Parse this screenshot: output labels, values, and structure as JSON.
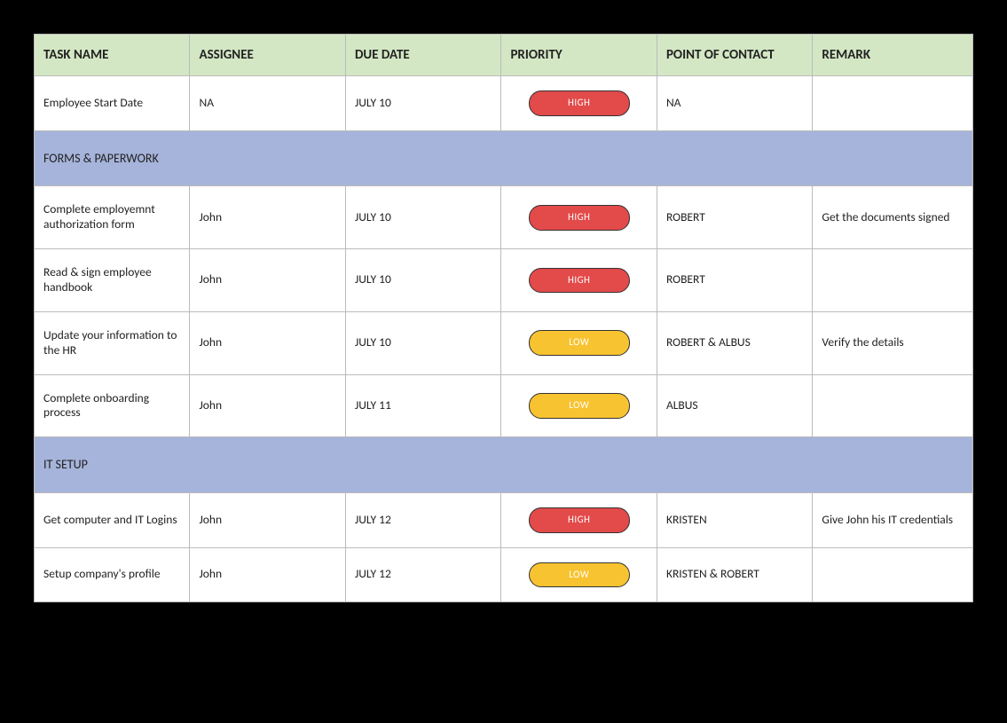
{
  "columns": {
    "task": "TASK NAME",
    "assignee": "ASSIGNEE",
    "due": "DUE DATE",
    "priority": "PRIORITY",
    "contact": "POINT OF CONTACT",
    "remark": "REMARK"
  },
  "rows": [
    {
      "type": "task",
      "task": "Employee Start Date",
      "assignee": "NA",
      "due": "JULY 10",
      "priority": "HIGH",
      "priority_level": "high",
      "contact": "NA",
      "remark": ""
    },
    {
      "type": "section",
      "label": "FORMS & PAPERWORK"
    },
    {
      "type": "task",
      "task": "Complete employemnt authorization form",
      "assignee": "John",
      "due": "JULY 10",
      "priority": "HIGH",
      "priority_level": "high",
      "contact": "ROBERT",
      "remark": "Get the documents signed"
    },
    {
      "type": "task",
      "task": "Read & sign employee handbook",
      "assignee": "John",
      "due": "JULY 10",
      "priority": "HIGH",
      "priority_level": "high",
      "contact": "ROBERT",
      "remark": ""
    },
    {
      "type": "task",
      "task": "Update your information to the HR",
      "assignee": "John",
      "due": "JULY 10",
      "priority": "LOW",
      "priority_level": "low",
      "contact": "ROBERT & ALBUS",
      "remark": "Verify the details"
    },
    {
      "type": "task",
      "task": "Complete onboarding process",
      "assignee": "John",
      "due": "JULY 11",
      "priority": "LOW",
      "priority_level": "low",
      "contact": "ALBUS",
      "remark": ""
    },
    {
      "type": "section",
      "label": "IT SETUP"
    },
    {
      "type": "task",
      "task": "Get computer and IT Logins",
      "assignee": "John",
      "due": "JULY 12",
      "priority": "HIGH",
      "priority_level": "high",
      "contact": "KRISTEN",
      "remark": "Give John his IT credentials"
    },
    {
      "type": "task",
      "task": "Setup company's profile",
      "assignee": "John",
      "due": "JULY 12",
      "priority": "LOW",
      "priority_level": "low",
      "contact": "KRISTEN & ROBERT",
      "remark": ""
    }
  ]
}
